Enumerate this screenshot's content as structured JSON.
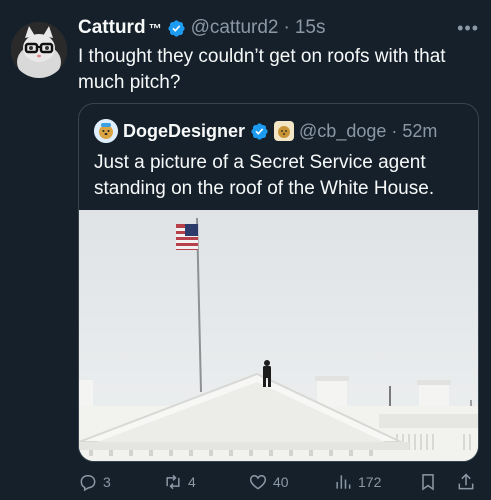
{
  "tweet": {
    "author_name": "Catturd",
    "author_tm": "™",
    "handle": "@catturd2",
    "separator": "·",
    "time": "15s",
    "text": "I thought they couldn’t get on roofs with that much pitch?",
    "more_icon": "more-dots-icon"
  },
  "quoted": {
    "author_name": "DogeDesigner",
    "handle": "@cb_doge",
    "separator": "·",
    "time": "52m",
    "text": "Just a picture of a Secret Service agent standing on the roof of the White House."
  },
  "actions": {
    "replies": "3",
    "reposts": "4",
    "likes": "40",
    "views": "172"
  },
  "colors": {
    "background": "#15202b",
    "accent": "#1d9bf0",
    "muted": "#8b98a5"
  }
}
